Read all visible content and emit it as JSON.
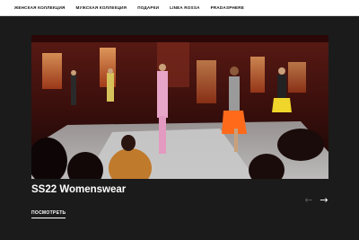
{
  "nav": {
    "items": [
      {
        "label": "ЖЕНСКАЯ КОЛЛЕКЦИЯ"
      },
      {
        "label": "МУЖСКАЯ КОЛЛЕКЦИЯ"
      },
      {
        "label": "ПОДАРКИ"
      },
      {
        "label": "LINEA ROSSA"
      },
      {
        "label": "PRADASPHERE"
      }
    ]
  },
  "hero": {
    "image": "runway-show-photo",
    "title": "SS22 Womenswear",
    "cta_label": "ПОСМОТРЕТЬ"
  },
  "carousel": {
    "prev_icon": "arrow-left-icon",
    "next_icon": "arrow-right-icon",
    "prev_glyph": "←",
    "next_glyph": "→"
  },
  "colors": {
    "background": "#1b1b1b",
    "nav_background": "#ffffff",
    "text_light": "#ffffff"
  }
}
